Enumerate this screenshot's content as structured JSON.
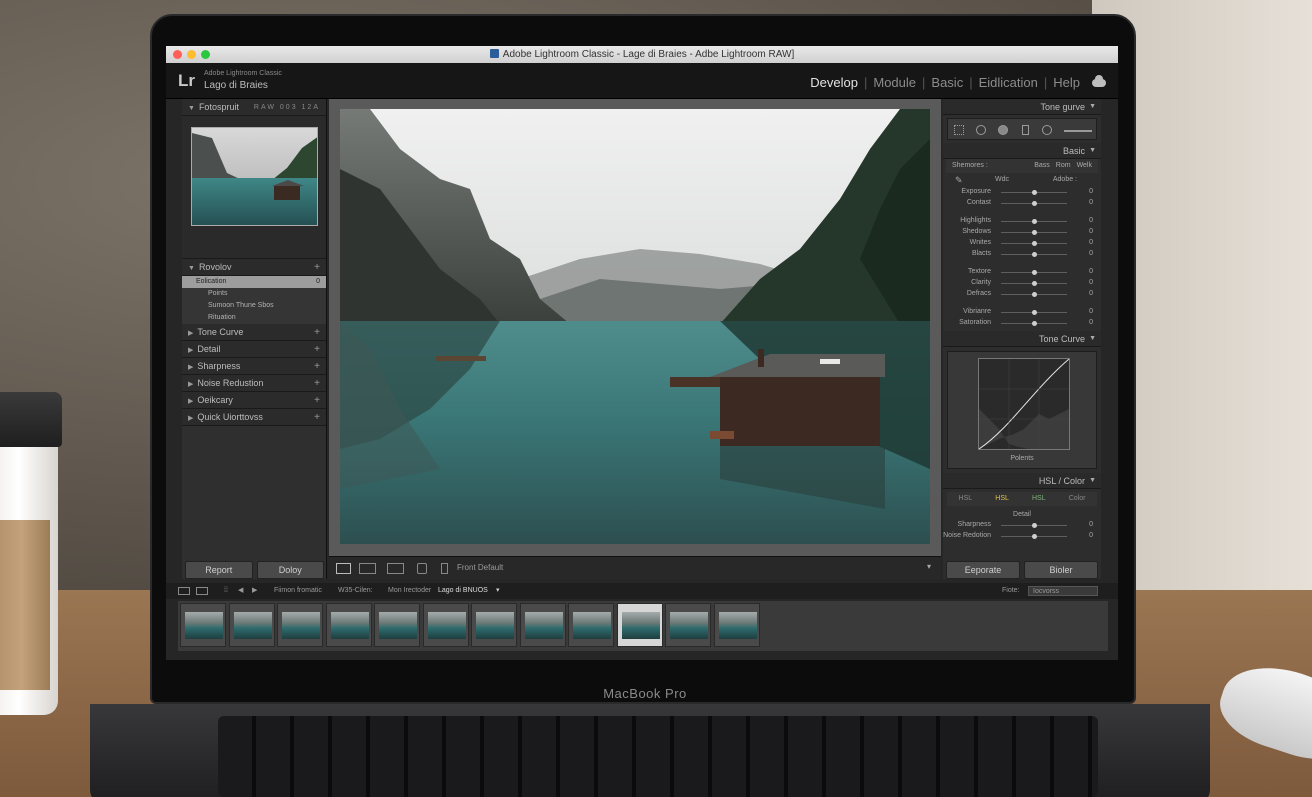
{
  "window": {
    "title": "Adobe Lightroom Classic - Lage di Braies - Adbe Lightroom RAW]"
  },
  "topbar": {
    "logo": "Lr",
    "catalog_sub": "Adobe Lightroom Classic",
    "catalog_title": "Lago di Braies",
    "modules": [
      "Develop",
      "Module",
      "Basic",
      "Eidlication",
      "Help"
    ],
    "active_module": "Develop"
  },
  "left_panel": {
    "navigator": {
      "label": "Fotospruit",
      "extras": "RAW  003  12A"
    },
    "presets": {
      "label": "Rovolov",
      "items": [
        {
          "label": "Eolication",
          "count": "0"
        },
        {
          "label": "Points"
        },
        {
          "label": "Sumoon Thune Sbos"
        },
        {
          "label": "Rituation"
        }
      ]
    },
    "sections": [
      "Tone Curve",
      "Detail",
      "Sharpness",
      "Noise Redustion",
      "Oeikcary",
      "Quick Uiorttovss"
    ],
    "buttons": {
      "left": "Report",
      "right": "Doloy"
    }
  },
  "center_toolbar": {
    "label": "Front Default"
  },
  "right_panel": {
    "tone_curve_top": "Tone gurve",
    "basic": {
      "label": "Basic",
      "tabs": [
        "Shemores :",
        "Bass",
        "Rom",
        "Welk"
      ],
      "wb_label": "Wdc",
      "wb_value": "Adobe :",
      "sliders": [
        {
          "label": "Exposure",
          "value": "0",
          "pos": 0.5
        },
        {
          "label": "Contast",
          "value": "0",
          "pos": 0.5
        },
        {
          "label": "Highlights",
          "value": "0",
          "pos": 0.5
        },
        {
          "label": "Shedows",
          "value": "0",
          "pos": 0.5
        },
        {
          "label": "Wnites",
          "value": "0",
          "pos": 0.5
        },
        {
          "label": "Blacts",
          "value": "0",
          "pos": 0.5
        },
        {
          "label": "Textore",
          "value": "0",
          "pos": 0.5
        },
        {
          "label": "Clarity",
          "value": "0",
          "pos": 0.5
        },
        {
          "label": "Defracs",
          "value": "0",
          "pos": 0.5
        },
        {
          "label": "Vibrianre",
          "value": "0",
          "pos": 0.5
        },
        {
          "label": "Satoration",
          "value": "0",
          "pos": 0.5
        }
      ]
    },
    "tone_curve": {
      "label": "Tone Curve",
      "sub": "Polents"
    },
    "hsl": {
      "label": "HSL / Color",
      "tabs": [
        "HSL",
        "HSL",
        "HSL",
        "Color"
      ],
      "detail_label": "Detail",
      "detail_sliders": [
        {
          "label": "Sharpness",
          "value": "0",
          "pos": 0.5
        },
        {
          "label": "Noise Redotion",
          "value": "0",
          "pos": 0.5
        }
      ]
    },
    "buttons": {
      "left": "Eeporate",
      "right": "Bioler"
    }
  },
  "filmstrip_bar": {
    "source": "Fiimon fromatic",
    "collection": "W35-Cilen:",
    "path_prefix": "Mon Irectoder",
    "path_name": "Lago di BNUOS",
    "filter_label": "Fiote:",
    "filter_value": "Iocvorss"
  },
  "filmstrip": {
    "count": 12,
    "selected_index": 9
  },
  "laptop": {
    "brand": "MacBook Pro"
  }
}
